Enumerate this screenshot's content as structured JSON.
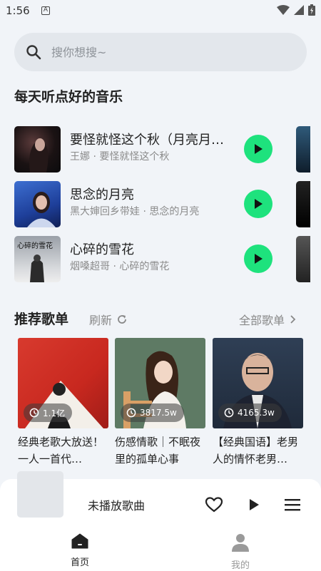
{
  "status_bar": {
    "time": "1:56",
    "notification_glyph": "A"
  },
  "search": {
    "placeholder": "搜你想搜~",
    "value": ""
  },
  "daily": {
    "title": "每天听点好的音乐",
    "songs": [
      {
        "title": "要怪就怪这个秋（月亮月…",
        "subtitle": "王娜 · 要怪就怪这个秋"
      },
      {
        "title": "思念的月亮",
        "subtitle": "黑大婶回乡带娃 · 思念的月亮"
      },
      {
        "title": "心碎的雪花",
        "subtitle": "烟嗓超哥 · 心碎的雪花"
      }
    ]
  },
  "cover_text": {
    "song3": "心碎的雪花"
  },
  "playlists": {
    "title": "推荐歌单",
    "refresh_label": "刷新",
    "all_label": "全部歌单",
    "items": [
      {
        "count": "1.1亿",
        "title": "经典老歌大放送！一人一首代…"
      },
      {
        "count": "3817.5w",
        "title": "伤感情歌｜不眠夜里的孤单心事"
      },
      {
        "count": "4165.3w",
        "title": "【经典国语】老男人的情怀老男…"
      }
    ]
  },
  "player": {
    "title": "未播放歌曲"
  },
  "nav": {
    "home_label": "首页",
    "mine_label": "我的"
  },
  "colors": {
    "accent": "#1ee27d",
    "background": "#f1f4f8",
    "nav_active": "#222222",
    "nav_inactive": "#9a9a9a"
  }
}
